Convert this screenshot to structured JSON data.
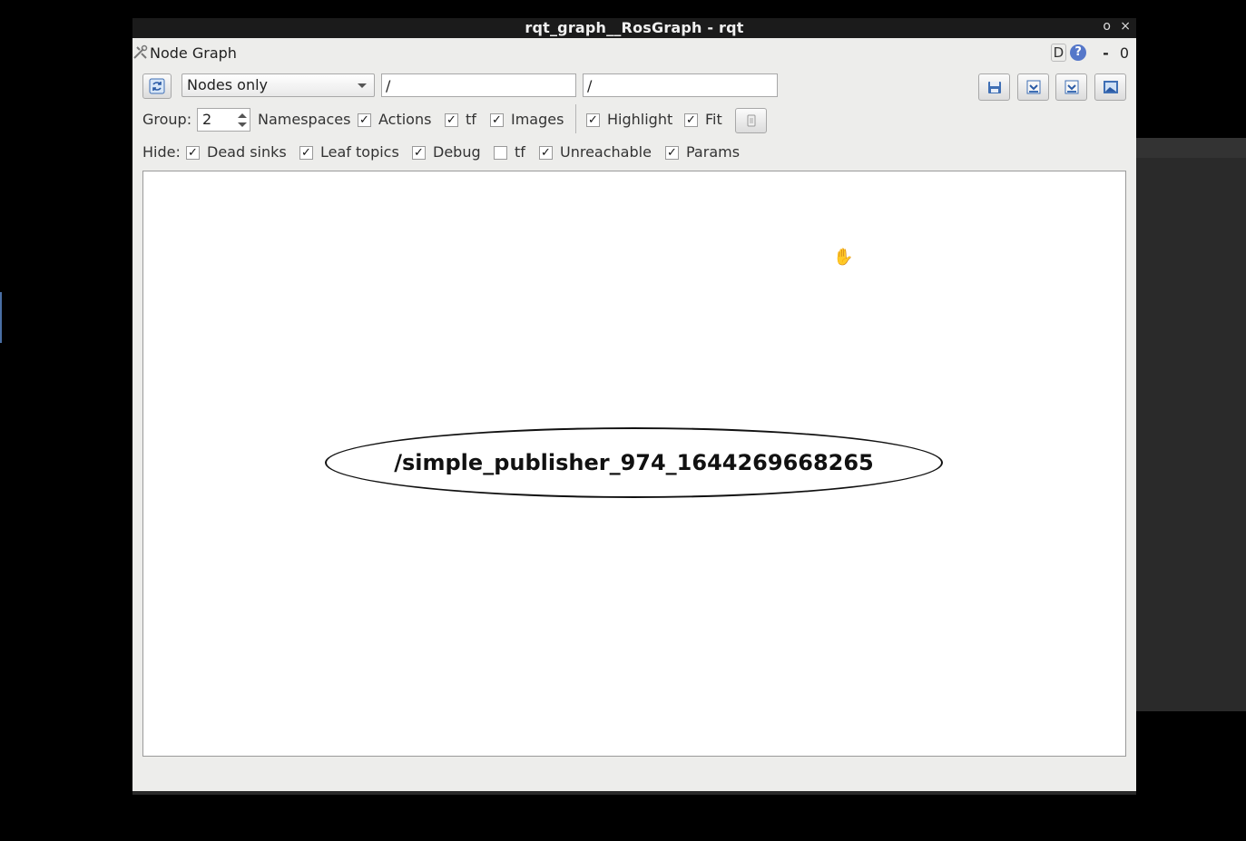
{
  "window": {
    "title": "rqt_graph__RosGraph - rqt",
    "restore_glyph": "o",
    "close_glyph": "×"
  },
  "plugin": {
    "title": "Node Graph",
    "d_label": "D",
    "help_label": "?",
    "minus_label": "-",
    "zero_label": "0"
  },
  "toolbar": {
    "filter_mode": "Nodes only",
    "node_filter_value": "/",
    "topic_filter_value": "/"
  },
  "options": {
    "group_label": "Group:",
    "group_value": "2",
    "checks": [
      {
        "label": "Namespaces",
        "checked": false
      },
      {
        "label": "Actions",
        "checked": true
      },
      {
        "label": "tf",
        "checked": true
      },
      {
        "label": "Images",
        "checked": true
      },
      {
        "label": "Highlight",
        "checked": true
      },
      {
        "label": "Fit",
        "checked": true
      }
    ]
  },
  "hide": {
    "label": "Hide:",
    "items": [
      {
        "label": "Dead sinks",
        "checked": true
      },
      {
        "label": "Leaf topics",
        "checked": true
      },
      {
        "label": "Debug",
        "checked": true
      },
      {
        "label": "tf",
        "checked": false
      },
      {
        "label": "Unreachable",
        "checked": true
      },
      {
        "label": "Params",
        "checked": true
      }
    ]
  },
  "graph": {
    "node_label": "/simple_publisher_974_1644269668265"
  },
  "colors": {
    "window_bg": "#ededeb",
    "titlebar": "#1b1b1b",
    "canvas": "#ffffff",
    "accent": "#5577c9"
  }
}
